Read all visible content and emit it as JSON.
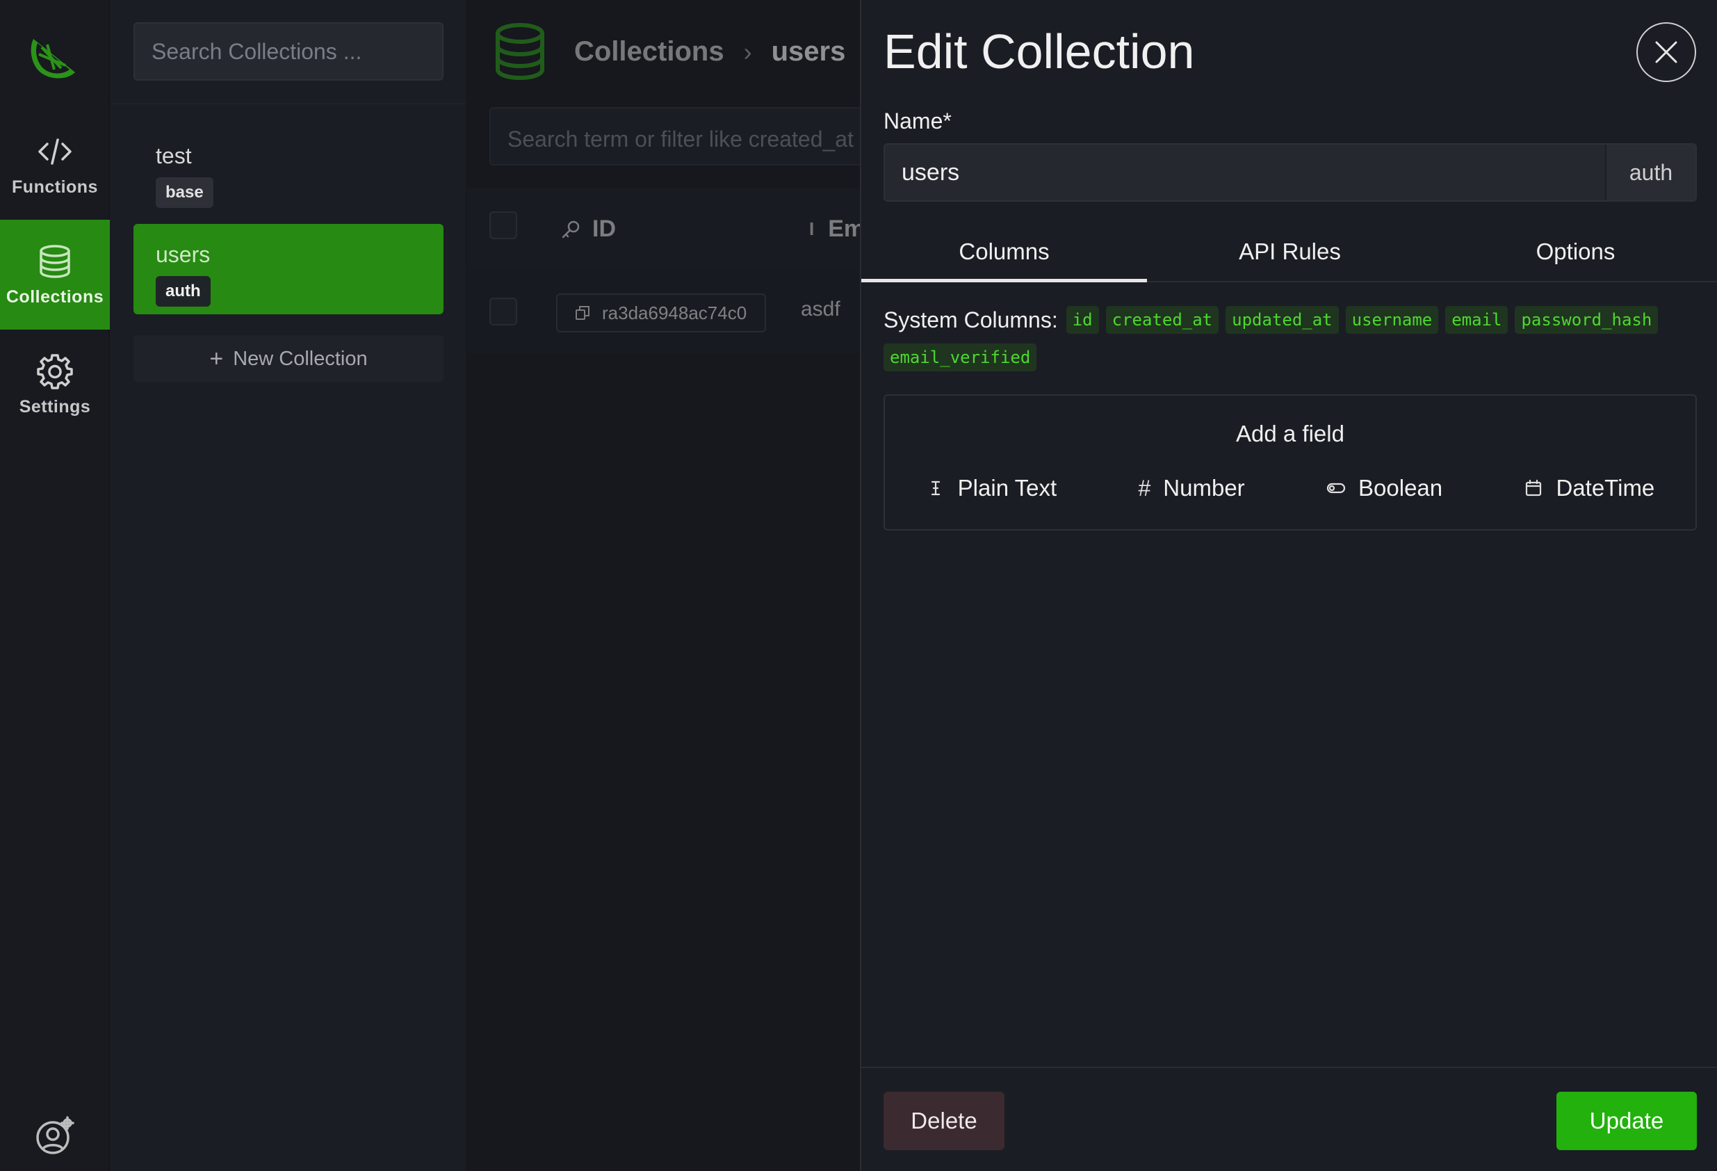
{
  "rail": {
    "items": [
      {
        "label": "Functions",
        "icon": "code-icon"
      },
      {
        "label": "Collections",
        "icon": "database-icon",
        "active": true
      },
      {
        "label": "Settings",
        "icon": "gear-icon"
      }
    ],
    "accent_color": "#278a12"
  },
  "sidebar": {
    "search_placeholder": "Search Collections ...",
    "collections": [
      {
        "name": "test",
        "type": "base"
      },
      {
        "name": "users",
        "type": "auth",
        "selected": true
      }
    ],
    "new_collection_label": "New Collection"
  },
  "main": {
    "breadcrumb": {
      "root": "Collections",
      "separator": "›",
      "current": "users"
    },
    "filter_placeholder": "Search term or filter like created_at",
    "table": {
      "columns": [
        "ID",
        "Em"
      ],
      "rows": [
        {
          "id": "ra3da6948ac74c0",
          "email": "asdf"
        }
      ]
    }
  },
  "panel": {
    "title": "Edit Collection",
    "name_label": "Name*",
    "name_value": "users",
    "name_suffix": "auth",
    "tabs": [
      "Columns",
      "API Rules",
      "Options"
    ],
    "active_tab": "Columns",
    "system_columns_label": "System Columns:",
    "system_columns": [
      "id",
      "created_at",
      "updated_at",
      "username",
      "email",
      "password_hash",
      "email_verified"
    ],
    "add_field": {
      "title": "Add a field",
      "types": [
        {
          "label": "Plain Text",
          "icon": "text-cursor-icon"
        },
        {
          "label": "Number",
          "icon": "hash-icon"
        },
        {
          "label": "Boolean",
          "icon": "toggle-icon"
        },
        {
          "label": "DateTime",
          "icon": "calendar-icon"
        }
      ]
    },
    "delete_label": "Delete",
    "update_label": "Update",
    "update_color": "#22b10d"
  }
}
